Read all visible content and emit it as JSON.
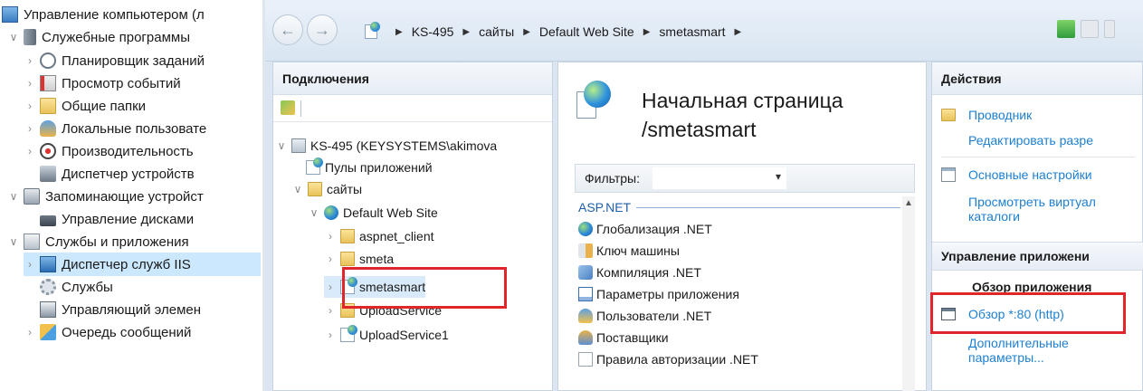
{
  "left_tree": {
    "items": [
      {
        "label": "Управление компьютером (л",
        "icon": "computer-management-icon",
        "arrow": ""
      },
      {
        "label": "Служебные программы",
        "icon": "tools-icon",
        "arrow": "∨"
      },
      {
        "label": "Планировщик заданий",
        "icon": "clock-icon",
        "arrow": "›"
      },
      {
        "label": "Просмотр событий",
        "icon": "event-viewer-icon",
        "arrow": "›"
      },
      {
        "label": "Общие папки",
        "icon": "shared-folders-icon",
        "arrow": "›"
      },
      {
        "label": "Локальные пользовате",
        "icon": "users-icon",
        "arrow": "›"
      },
      {
        "label": "Производительность",
        "icon": "performance-icon",
        "arrow": "›"
      },
      {
        "label": "Диспетчер устройств",
        "icon": "device-manager-icon",
        "arrow": ""
      },
      {
        "label": "Запоминающие устройст",
        "icon": "storage-icon",
        "arrow": "∨"
      },
      {
        "label": "Управление дисками",
        "icon": "disk-management-icon",
        "arrow": ""
      },
      {
        "label": "Службы и приложения",
        "icon": "services-apps-icon",
        "arrow": "∨"
      },
      {
        "label": "Диспетчер служб IIS",
        "icon": "iis-manager-icon",
        "arrow": "›"
      },
      {
        "label": "Службы",
        "icon": "services-icon",
        "arrow": ""
      },
      {
        "label": "Управляющий элемен",
        "icon": "wmi-control-icon",
        "arrow": ""
      },
      {
        "label": "Очередь сообщений",
        "icon": "message-queue-icon",
        "arrow": "›"
      }
    ]
  },
  "addressbar": {
    "back": "←",
    "forward": "→",
    "crumbs": [
      "KS-495",
      "сайты",
      "Default Web Site",
      "smetasmart"
    ],
    "sep": "▶"
  },
  "connections": {
    "title": "Подключения",
    "server": "KS-495 (KEYSYSTEMS\\akimova",
    "app_pools": "Пулы приложений",
    "sites": "сайты",
    "default_site": "Default Web Site",
    "aspnet_client": "aspnet_client",
    "smeta": "smeta",
    "smetasmart": "smetasmart",
    "upload_service": "UploadService",
    "upload_service1": "UploadService1"
  },
  "center": {
    "title_line1": "Начальная страница",
    "title_line2": "/smetasmart",
    "filter_label": "Фильтры:",
    "group": "ASP.NET",
    "features": [
      "Глобализация .NET",
      "Ключ машины",
      "Компиляция .NET",
      "Параметры приложения",
      "Пользователи .NET",
      "Поставщики",
      "Правила авторизации .NET"
    ]
  },
  "actions": {
    "title": "Действия",
    "explore": "Проводник",
    "edit_permissions": "Редактировать разре",
    "basic_settings": "Основные настройки",
    "view_virtual_line1": "Просмотреть виртуал",
    "view_virtual_line2": "каталоги",
    "manage_app": "Управление приложени",
    "browse_app": "Обзор приложения",
    "browse_80": "Обзор *:80 (http)",
    "advanced_line1": "Дополнительные",
    "advanced_line2": "параметры..."
  },
  "colors": {
    "highlight": "#e0262b",
    "link": "#1d7fd0",
    "selection": "#cce8ff"
  }
}
